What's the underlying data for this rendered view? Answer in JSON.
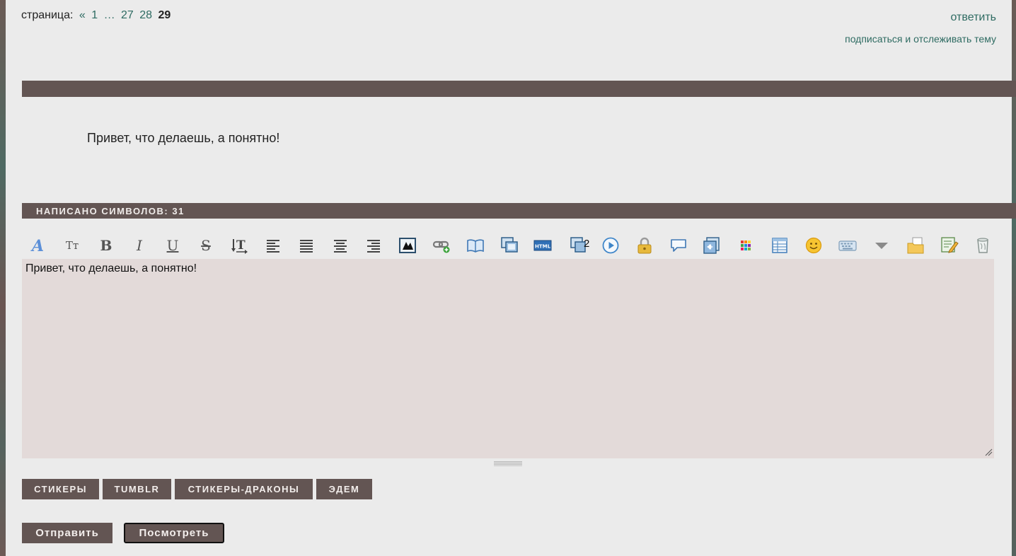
{
  "pagination": {
    "label": "страница:",
    "prev": "«",
    "first": "1",
    "ellipsis": "…",
    "pages": [
      "27",
      "28"
    ],
    "current": "29"
  },
  "top_links": {
    "reply": "ответить",
    "subscribe": "подписаться и отслеживать тему"
  },
  "preview": {
    "text": "Привет, что делаешь, а понятно!"
  },
  "counter": {
    "label": "НАПИСАНО СИМВОЛОВ: 31"
  },
  "toolbar": {
    "font_size_label": "Tт",
    "bold_label": "B",
    "italic_label": "I",
    "underline_label": "U",
    "strike_label": "S",
    "badge_2": "2"
  },
  "editor": {
    "value": "Привет, что делаешь, а понятно!"
  },
  "tags": {
    "stickers": "СТИКЕРЫ",
    "tumblr": "TUMBLR",
    "dragons": "СТИКЕРЫ-ДРАКОНЫ",
    "edem": "ЭДЕМ"
  },
  "actions": {
    "send": "Отправить",
    "preview": "Посмотреть"
  },
  "colors": {
    "band": "#635553",
    "link": "#2e6b62",
    "editor_bg": "#e3dad9",
    "page_bg": "#ebebeb"
  }
}
